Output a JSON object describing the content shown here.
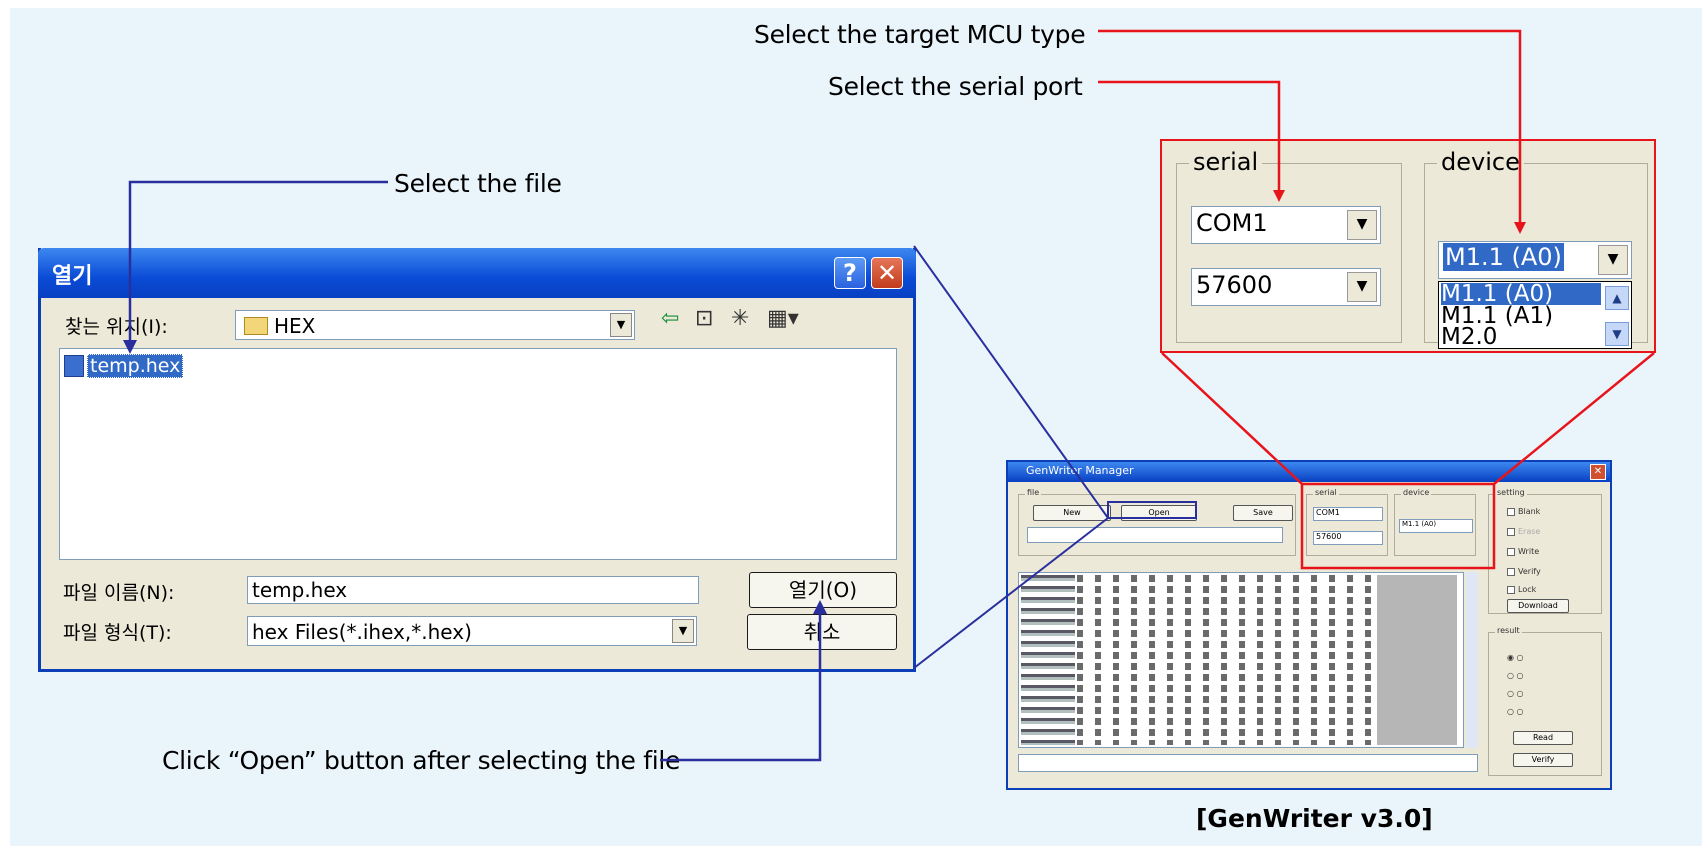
{
  "callouts": {
    "mcu": "Select the target MCU type",
    "port": "Select the serial port",
    "file": "Select the file",
    "open": "Click “Open” button after selecting the file"
  },
  "dialog": {
    "title": "열기",
    "help_glyph": "?",
    "close_glyph": "✕",
    "lookin_label": "찾는 위치(I):",
    "lookin_value": "HEX",
    "files": [
      "temp.hex"
    ],
    "filename_label": "파일 이름(N):",
    "filename_value": "temp.hex",
    "filetype_label": "파일 형식(T):",
    "filetype_value": "hex Files(*.ihex,*.hex)",
    "open_button": "열기(O)",
    "cancel_button": "취소"
  },
  "zoom_panel": {
    "serial_title": "serial",
    "port_value": "COM1",
    "baud_value": "57600",
    "device_title": "device",
    "device_value": "M1.1 (A0)",
    "device_options": [
      "M1.1 (A0)",
      "M1.1 (A1)",
      "M2.0"
    ]
  },
  "genwriter": {
    "title": "GenWriter Manager",
    "file_group": "file",
    "new_button": "New",
    "open_button": "Open",
    "save_button": "Save",
    "serial_group": "serial",
    "serial_port": "COM1",
    "serial_baud": "57600",
    "device_group": "device",
    "device_value": "M1.1 (A0)",
    "setting_group": "setting",
    "setting_items": [
      "Blank",
      "Erase",
      "Write",
      "Verify",
      "Lock"
    ],
    "download_button": "Download",
    "result_group": "result",
    "read_button": "Read",
    "verify_button": "Verify"
  },
  "caption": "[GenWriter v3.0]",
  "colors": {
    "red_callout": "#e8141b",
    "blue_callout": "#2a2f9e",
    "background": "#eaf5fb",
    "xp_title": "#0a4bd6"
  }
}
